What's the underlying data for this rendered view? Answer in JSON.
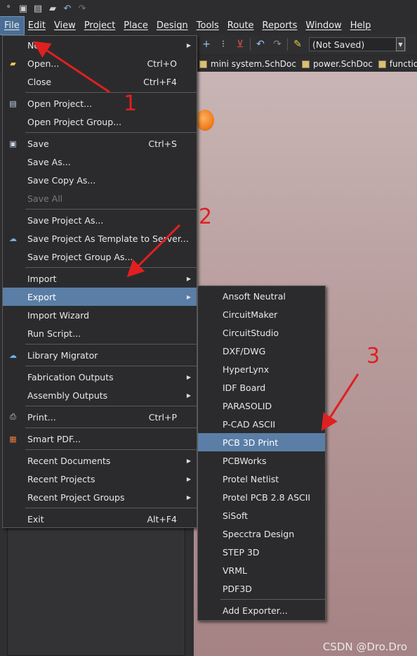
{
  "menubar": [
    "File",
    "Edit",
    "View",
    "Project",
    "Place",
    "Design",
    "Tools",
    "Route",
    "Reports",
    "Window",
    "Help"
  ],
  "toolbar": {
    "variant": "(Not Saved)"
  },
  "doc_tabs": [
    "mini system.SchDoc",
    "power.SchDoc",
    "function.Sch"
  ],
  "file_menu": [
    {
      "label": "New",
      "shortcut": "",
      "submenu": true,
      "icon": ""
    },
    {
      "label": "Open...",
      "shortcut": "Ctrl+O",
      "icon": "folder-open-icon"
    },
    {
      "label": "Close",
      "shortcut": "Ctrl+F4"
    },
    {
      "label": "Open Project...",
      "shortcut": "",
      "icon": "project-icon"
    },
    {
      "label": "Open Project Group...",
      "shortcut": ""
    },
    {
      "label": "Save",
      "shortcut": "Ctrl+S",
      "icon": "save-icon"
    },
    {
      "label": "Save As...",
      "shortcut": ""
    },
    {
      "label": "Save Copy As...",
      "shortcut": ""
    },
    {
      "label": "Save All",
      "shortcut": "",
      "disabled": true
    },
    {
      "label": "Save Project As...",
      "shortcut": ""
    },
    {
      "label": "Save Project As Template to Server...",
      "shortcut": "",
      "icon": "cloud-upload-icon"
    },
    {
      "label": "Save Project Group As...",
      "shortcut": ""
    },
    {
      "label": "Import",
      "shortcut": "",
      "submenu": true
    },
    {
      "label": "Export",
      "shortcut": "",
      "submenu": true
    },
    {
      "label": "Import Wizard",
      "shortcut": ""
    },
    {
      "label": "Run Script...",
      "shortcut": ""
    },
    {
      "label": "Library Migrator",
      "shortcut": "",
      "icon": "cloud-icon"
    },
    {
      "label": "Fabrication Outputs",
      "shortcut": "",
      "submenu": true
    },
    {
      "label": "Assembly Outputs",
      "shortcut": "",
      "submenu": true
    },
    {
      "label": "Print...",
      "shortcut": "Ctrl+P",
      "icon": "printer-icon"
    },
    {
      "label": "Smart PDF...",
      "shortcut": "",
      "icon": "pdf-icon"
    },
    {
      "label": "Recent Documents",
      "shortcut": "",
      "submenu": true
    },
    {
      "label": "Recent Projects",
      "shortcut": "",
      "submenu": true
    },
    {
      "label": "Recent Project Groups",
      "shortcut": "",
      "submenu": true
    },
    {
      "label": "Exit",
      "shortcut": "Alt+F4"
    }
  ],
  "export_menu": [
    "Ansoft Neutral",
    "CircuitMaker",
    "CircuitStudio",
    "DXF/DWG",
    "HyperLynx",
    "IDF Board",
    "PARASOLID",
    "P-CAD ASCII",
    "PCB 3D Print",
    "PCBWorks",
    "Protel Netlist",
    "Protel PCB 2.8 ASCII",
    "SiSoft",
    "Specctra Design",
    "STEP 3D",
    "VRML",
    "PDF3D",
    "Add Exporter..."
  ],
  "annotations": [
    "1",
    "2",
    "3"
  ],
  "watermark": "CSDN @Dro.Dro"
}
